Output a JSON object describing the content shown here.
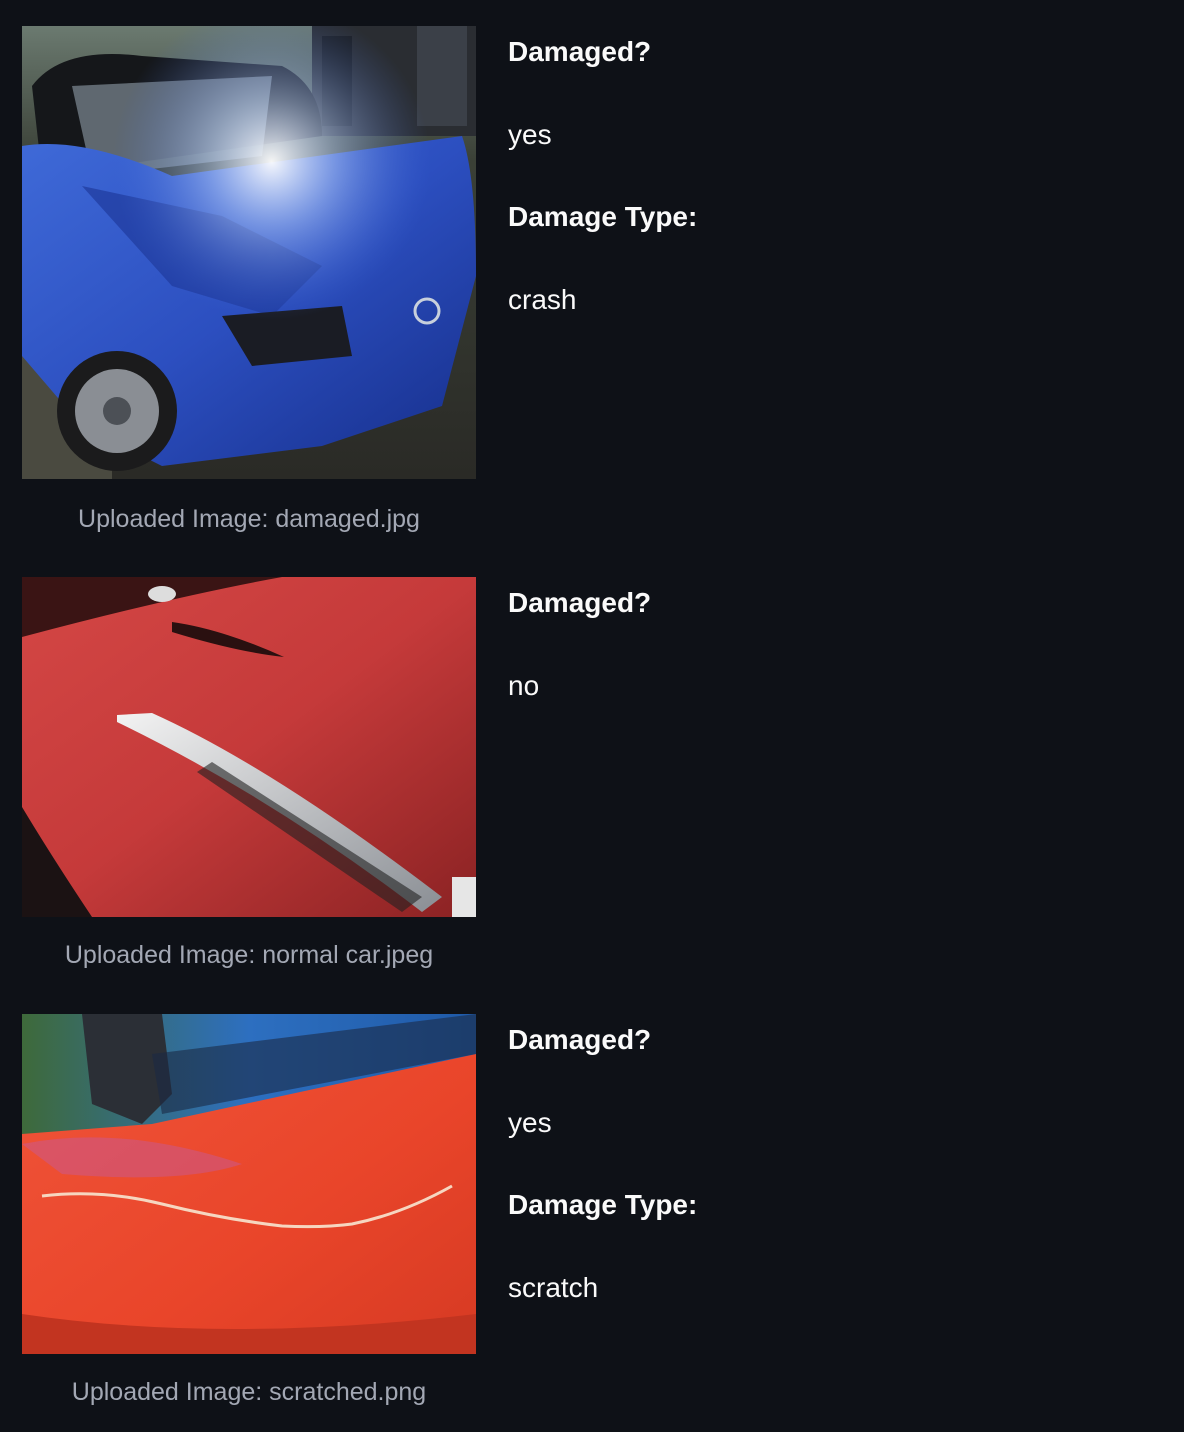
{
  "results": [
    {
      "caption": "Uploaded Image: damaged.jpg",
      "photo_icon": "crashed-blue-car-photo",
      "damaged_label": "Damaged?",
      "damaged_value": "yes",
      "type_label": "Damage Type:",
      "type_value": "crash"
    },
    {
      "caption": "Uploaded Image: normal car.jpeg",
      "photo_icon": "red-car-hood-photo",
      "damaged_label": "Damaged?",
      "damaged_value": "no"
    },
    {
      "caption": "Uploaded Image: scratched.png",
      "photo_icon": "scratched-orange-car-photo",
      "damaged_label": "Damaged?",
      "damaged_value": "yes",
      "type_label": "Damage Type:",
      "type_value": "scratch"
    }
  ],
  "colors": {
    "background": "#0e1117",
    "text": "#fafafa",
    "caption": "#a3a8b4"
  }
}
